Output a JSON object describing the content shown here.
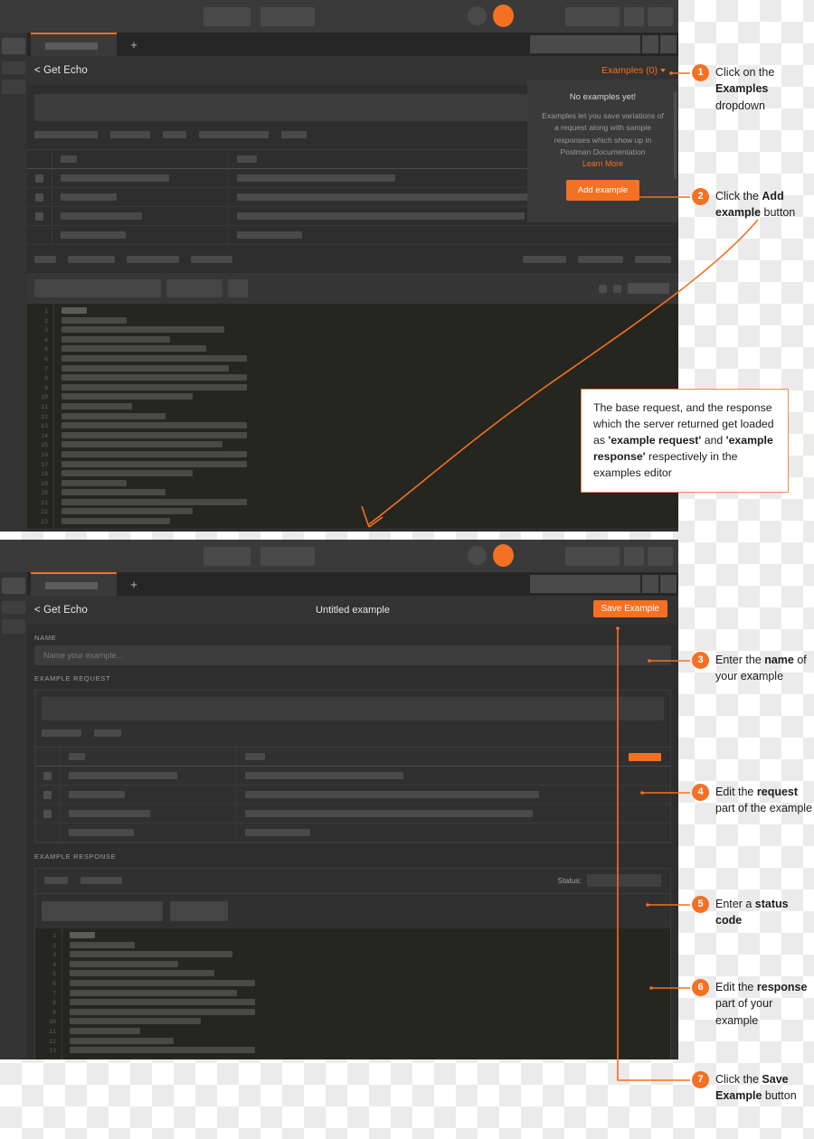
{
  "app": {
    "accent": "#f47023",
    "panel_bg": "#2e2e2e",
    "editor_bg": "#262621"
  },
  "top_panel": {
    "tab_plus_label": "+",
    "request_title": "Get Echo",
    "back_chevron": "<",
    "examples_dropdown_label": "Examples (0)",
    "examples_popover": {
      "title": "No examples yet!",
      "body": "Examples let you save variations of a request along with sample responses which show up in Postman Documentation",
      "link_label": "Learn More",
      "button_label": "Add example"
    },
    "editor_line_numbers": [
      1,
      2,
      3,
      4,
      5,
      6,
      7,
      8,
      9,
      10,
      11,
      12,
      13,
      14,
      15,
      16,
      17,
      18,
      19,
      20,
      21,
      22,
      23
    ],
    "editor_line_widths": [
      28,
      72,
      180,
      120,
      160,
      205,
      185,
      205,
      205,
      145,
      78,
      115,
      205,
      205,
      178,
      205,
      205,
      145,
      72,
      115,
      205,
      145,
      120
    ],
    "table_rows": [
      {
        "key_width": 120,
        "value_width": 175
      },
      {
        "key_width": 62,
        "value_width": 325
      },
      {
        "key_width": 90,
        "value_width": 318
      },
      {
        "key_width": 72,
        "value_width": 72
      }
    ]
  },
  "bottom_panel": {
    "tab_plus_label": "+",
    "back_chevron": "<",
    "request_title": "Get Echo",
    "example_title": "Untitled example",
    "save_button_label": "Save Example",
    "name_section_label": "NAME",
    "name_placeholder": "Name your example...",
    "example_request_label": "EXAMPLE REQUEST",
    "example_response_label": "EXAMPLE RESPONSE",
    "status_label": "Status:",
    "editor_line_numbers": [
      1,
      2,
      3,
      4,
      5,
      6,
      7,
      8,
      9,
      10,
      11,
      12,
      13
    ],
    "editor_line_widths": [
      28,
      72,
      180,
      120,
      160,
      205,
      185,
      205,
      205,
      145,
      78,
      115,
      205
    ],
    "table_rows": [
      {
        "key_width": 120,
        "value_width": 175
      },
      {
        "key_width": 62,
        "value_width": 325
      },
      {
        "key_width": 90,
        "value_width": 318
      },
      {
        "key_width": 72,
        "value_width": 72
      }
    ]
  },
  "steps": [
    {
      "num": "1",
      "html": "Click on the <b>Examples</b> dropdown"
    },
    {
      "num": "2",
      "html": "Click the <b>Add example</b> button"
    },
    {
      "num": "3",
      "html": "Enter the <b>name</b> of your example"
    },
    {
      "num": "4",
      "html": "Edit the <b>request</b> part of the example"
    },
    {
      "num": "5",
      "html": "Enter a <b>status code</b>"
    },
    {
      "num": "6",
      "html": "Edit the <b>response</b> part of your example"
    },
    {
      "num": "7",
      "html": "Click the <b>Save Example</b> button"
    }
  ],
  "callout": {
    "html": "The base request, and the response which the server returned get loaded as <b>'example request'</b> and <b>'example response'</b> respectively in the examples editor"
  }
}
